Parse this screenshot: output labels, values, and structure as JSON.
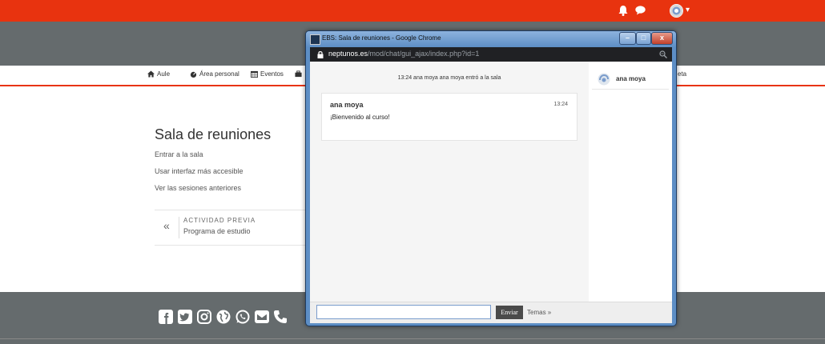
{
  "site": {
    "topbar": {
      "caret": "▾"
    },
    "nav": [
      {
        "label": "Aule",
        "icon": "home-icon"
      },
      {
        "label": "Área personal",
        "icon": "dashboard-icon"
      },
      {
        "label": "Eventos",
        "icon": "calendar-icon"
      },
      {
        "label": "",
        "icon": "briefcase-icon"
      }
    ],
    "nav_right_fragment": "eta",
    "page_title": "Sala de reuniones",
    "links": [
      "Entrar a la sala",
      "Usar interfaz más accesible",
      "Ver las sesiones anteriores"
    ],
    "prev_activity": {
      "arrow": "«",
      "label": "ACTIVIDAD PREVIA",
      "title": "Programa de estudio"
    },
    "footer_icons": [
      "facebook-icon",
      "twitter-icon",
      "instagram-icon",
      "globe-icon",
      "whatsapp-icon",
      "mail-icon",
      "phone-icon"
    ]
  },
  "popup": {
    "title": "EBS: Sala de reuniones - Google Chrome",
    "buttons": {
      "minimize": "–",
      "maximize": "□",
      "close": "x"
    },
    "url_host": "neptunos.es",
    "url_path": "/mod/chat/gui_ajax/index.php?id=1",
    "system_message": "13:24 ana moya ana moya entró a la sala",
    "message": {
      "user": "ana moya",
      "time": "13:24",
      "text": "¡Bienvenido al curso!"
    },
    "users": [
      {
        "name": "ana moya"
      }
    ],
    "input_value": "",
    "send_label": "Enviar",
    "themes_label": "Temas »"
  },
  "colors": {
    "brand_orange": "#e8330f",
    "header_grey": "#656b6d",
    "window_blue": "#5d8ec5"
  }
}
